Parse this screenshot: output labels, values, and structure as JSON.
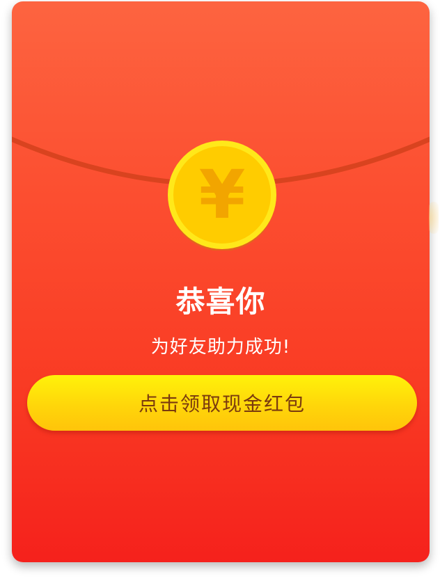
{
  "envelope": {
    "title": "恭喜你",
    "subtitle": "为好友助力成功!",
    "claim_button_label": "点击领取现金红包"
  },
  "coin": {
    "symbol": "¥",
    "icon": "yuan-coin-icon"
  },
  "colors": {
    "envelope_top": "#fd6440",
    "envelope_bottom": "#f5211c",
    "button_yellow": "#ffd60a",
    "button_text": "#7a3a0e",
    "coin_gold": "#ffcf00"
  }
}
